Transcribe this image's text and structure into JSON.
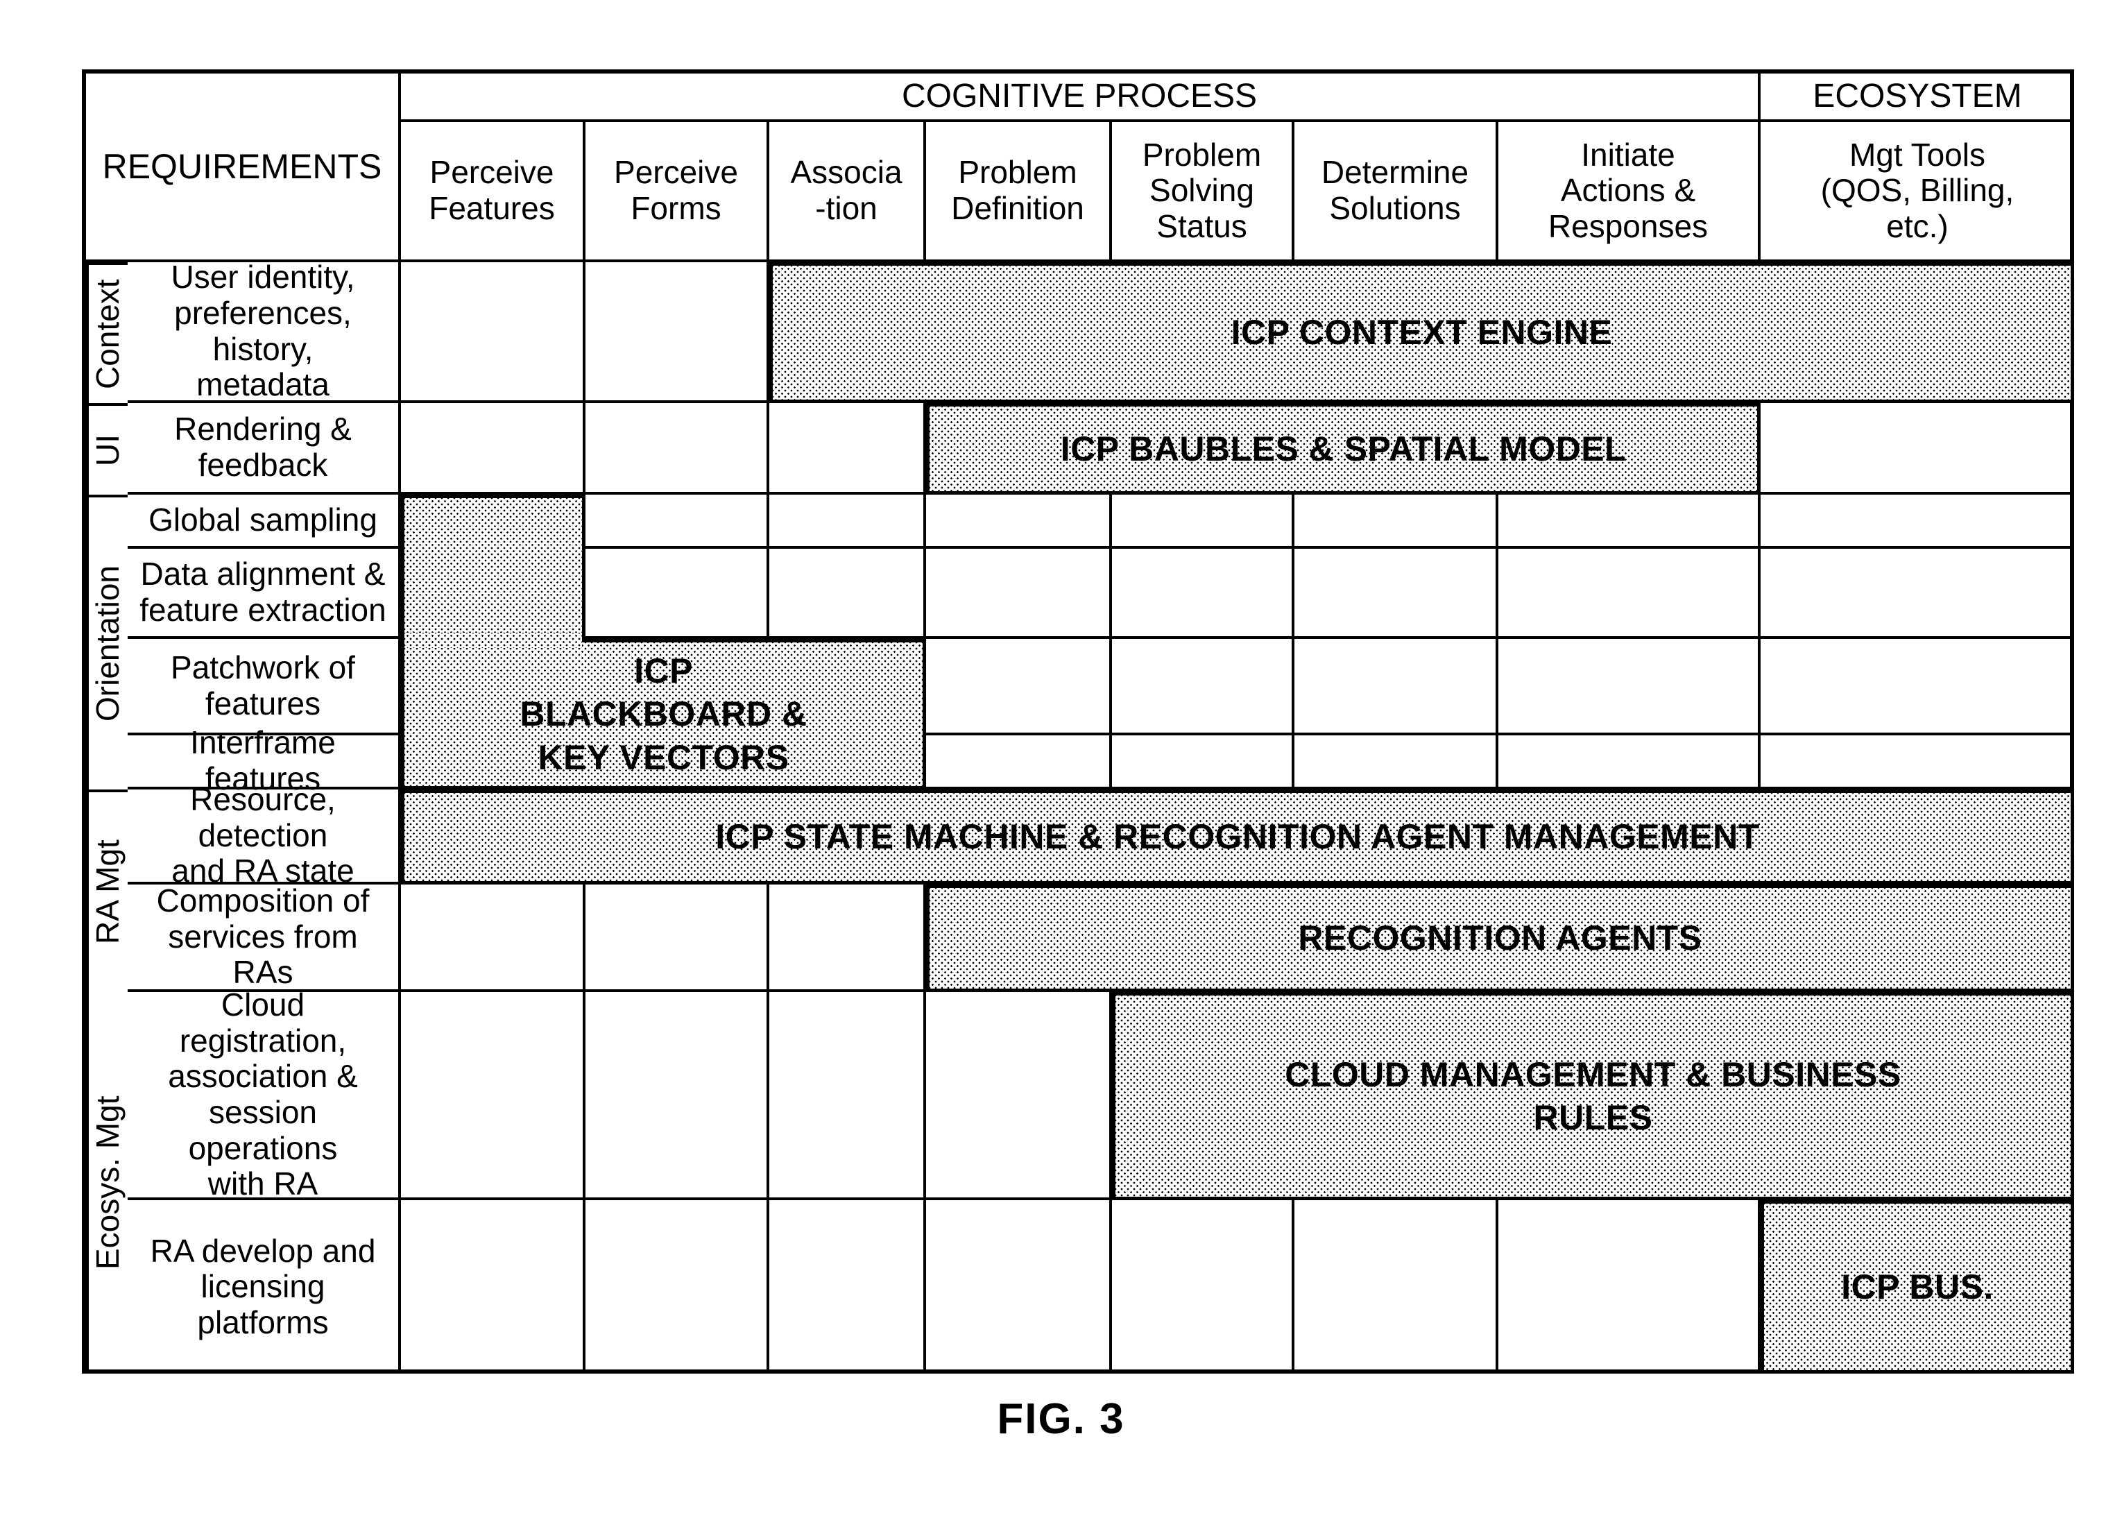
{
  "figure": {
    "caption": "FIG. 3",
    "requirements_header": "REQUIREMENTS",
    "top_groups": [
      {
        "label": "COGNITIVE PROCESS"
      },
      {
        "label": "ECOSYSTEM"
      }
    ],
    "columns": [
      {
        "label": "Perceive Features",
        "line1": "Perceive",
        "line2": "Features"
      },
      {
        "label": "Perceive Forms",
        "line1": "Perceive",
        "line2": "Forms"
      },
      {
        "label": "Associa -tion",
        "line1": "Associa",
        "line2": "-tion"
      },
      {
        "label": "Problem Definition",
        "line1": "Problem",
        "line2": "Definition"
      },
      {
        "label": "Problem Solving Status",
        "line1": "Problem",
        "line2": "Solving",
        "line3": "Status"
      },
      {
        "label": "Determine Solutions",
        "line1": "Determine",
        "line2": "Solutions"
      },
      {
        "label": "Initiate Actions & Responses",
        "line1": "Initiate",
        "line2": "Actions &",
        "line3": "Responses"
      },
      {
        "label": "Mgt Tools (QOS, Billing, etc.)",
        "line1": "Mgt Tools",
        "line2": "(QOS, Billing,",
        "line3": "etc.)"
      }
    ],
    "groups": [
      {
        "label": "Context"
      },
      {
        "label": "UI"
      },
      {
        "label": "Orientation"
      },
      {
        "label": "RA Mgt"
      },
      {
        "label": "Ecosys. Mgt"
      }
    ],
    "rows": [
      {
        "desc_line1": "User identity,",
        "desc_line2": "preferences, history,",
        "desc_line3": "metadata"
      },
      {
        "desc_line1": "Rendering &",
        "desc_line2": "feedback"
      },
      {
        "desc_line1": "Global sampling"
      },
      {
        "desc_line1": "Data alignment &",
        "desc_line2": "feature extraction"
      },
      {
        "desc_line1": "Patchwork of",
        "desc_line2": "features"
      },
      {
        "desc_line1": "Interframe features"
      },
      {
        "desc_line1": "Resource, detection",
        "desc_line2": "and RA state"
      },
      {
        "desc_line1": "Composition of",
        "desc_line2": "services from RAs"
      },
      {
        "desc_line1": "Cloud registration,",
        "desc_line2": "association &",
        "desc_line3": "session operations",
        "desc_line4": "with RA"
      },
      {
        "desc_line1": "RA develop and",
        "desc_line2": "licensing platforms"
      }
    ],
    "blocks": [
      {
        "id": "context-engine",
        "label": "ICP CONTEXT ENGINE"
      },
      {
        "id": "baubles",
        "label": "ICP BAUBLES & SPATIAL MODEL"
      },
      {
        "id": "blackboard",
        "line1": "ICP",
        "line2": "BLACKBOARD &",
        "line3": "KEY VECTORS"
      },
      {
        "id": "state-machine",
        "label": "ICP STATE MACHINE & RECOGNITION AGENT MANAGEMENT"
      },
      {
        "id": "recognition-agents",
        "label": "RECOGNITION AGENTS"
      },
      {
        "id": "cloud-management",
        "line1": "CLOUD MANAGEMENT & BUSINESS",
        "line2": "RULES"
      },
      {
        "id": "icp-bus",
        "label": "ICP BUS."
      }
    ]
  },
  "chart_data": {
    "type": "table",
    "title": "FIG. 3",
    "row_header_label": "REQUIREMENTS",
    "column_groups": [
      "COGNITIVE PROCESS",
      "ECOSYSTEM"
    ],
    "columns": [
      "Perceive Features",
      "Perceive Forms",
      "Associa-tion",
      "Problem Definition",
      "Problem Solving Status",
      "Determine Solutions",
      "Initiate Actions & Responses",
      "Mgt Tools (QOS, Billing, etc.)"
    ],
    "row_groups": [
      "Context",
      "UI",
      "Orientation",
      "RA Mgt",
      "Ecosys. Mgt"
    ],
    "rows": [
      "User identity, preferences, history, metadata",
      "Rendering & feedback",
      "Global sampling",
      "Data alignment & feature extraction",
      "Patchwork of features",
      "Interframe features",
      "Resource, detection and RA state",
      "Composition of services from RAs",
      "Cloud registration, association & session operations with RA",
      "RA develop and licensing platforms"
    ],
    "spans": [
      {
        "label": "ICP CONTEXT ENGINE",
        "rows": [
          "User identity, preferences, history, metadata"
        ],
        "columns": [
          "Associa-tion",
          "Problem Definition",
          "Problem Solving Status",
          "Determine Solutions",
          "Initiate Actions & Responses",
          "Mgt Tools (QOS, Billing, etc.)"
        ]
      },
      {
        "label": "ICP BAUBLES & SPATIAL MODEL",
        "rows": [
          "Rendering & feedback"
        ],
        "columns": [
          "Problem Definition",
          "Problem Solving Status",
          "Determine Solutions",
          "Initiate Actions & Responses"
        ]
      },
      {
        "label": "ICP BLACKBOARD & KEY VECTORS",
        "rows": [
          "Global sampling",
          "Data alignment & feature extraction",
          "Patchwork of features",
          "Interframe features"
        ],
        "columns": [
          "Perceive Features",
          "Perceive Forms",
          "Associa-tion"
        ],
        "shape": "stepped"
      },
      {
        "label": "ICP STATE MACHINE & RECOGNITION AGENT MANAGEMENT",
        "rows": [
          "Resource, detection and RA state"
        ],
        "columns": [
          "Perceive Features",
          "Perceive Forms",
          "Associa-tion",
          "Problem Definition",
          "Problem Solving Status",
          "Determine Solutions",
          "Initiate Actions & Responses",
          "Mgt Tools (QOS, Billing, etc.)"
        ]
      },
      {
        "label": "RECOGNITION AGENTS",
        "rows": [
          "Composition of services from RAs"
        ],
        "columns": [
          "Problem Definition",
          "Problem Solving Status",
          "Determine Solutions",
          "Initiate Actions & Responses",
          "Mgt Tools (QOS, Billing, etc.)"
        ]
      },
      {
        "label": "CLOUD MANAGEMENT & BUSINESS RULES",
        "rows": [
          "Cloud registration, association & session operations with RA"
        ],
        "columns": [
          "Problem Solving Status",
          "Determine Solutions",
          "Initiate Actions & Responses",
          "Mgt Tools (QOS, Billing, etc.)"
        ]
      },
      {
        "label": "ICP BUS.",
        "rows": [
          "RA develop and licensing platforms"
        ],
        "columns": [
          "Mgt Tools (QOS, Billing, etc.)"
        ]
      }
    ]
  }
}
